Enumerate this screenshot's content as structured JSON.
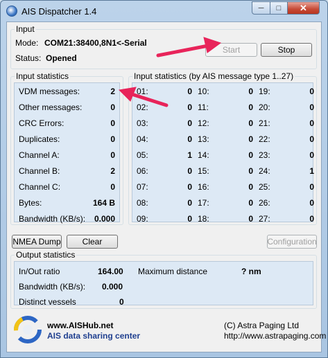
{
  "window": {
    "title": "AIS Dispatcher 1.4",
    "close_glyph": "✕",
    "min_glyph": "─",
    "max_glyph": "□"
  },
  "input": {
    "title": "Input",
    "mode_label": "Mode:",
    "mode_value": "COM21:38400,8N1<-Serial",
    "status_label": "Status:",
    "status_value": "Opened",
    "start_label": "Start",
    "stop_label": "Stop"
  },
  "input_stats": {
    "title": "Input statistics",
    "rows": [
      {
        "label": "VDM messages:",
        "value": "2"
      },
      {
        "label": "Other messages:",
        "value": "0"
      },
      {
        "label": "CRC Errors:",
        "value": "0"
      },
      {
        "label": "Duplicates:",
        "value": "0"
      },
      {
        "label": "Channel A:",
        "value": "0"
      },
      {
        "label": "Channel B:",
        "value": "2"
      },
      {
        "label": "Channel C:",
        "value": "0"
      },
      {
        "label": "Bytes:",
        "value": "164 B"
      },
      {
        "label": "Bandwidth (KB/s):",
        "value": "0.000"
      }
    ]
  },
  "type_stats": {
    "title": "Input statistics (by AIS message type 1..27)",
    "columns": [
      [
        {
          "label": "01:",
          "value": "0"
        },
        {
          "label": "02:",
          "value": "0"
        },
        {
          "label": "03:",
          "value": "0"
        },
        {
          "label": "04:",
          "value": "0"
        },
        {
          "label": "05:",
          "value": "1"
        },
        {
          "label": "06:",
          "value": "0"
        },
        {
          "label": "07:",
          "value": "0"
        },
        {
          "label": "08:",
          "value": "0"
        },
        {
          "label": "09:",
          "value": "0"
        }
      ],
      [
        {
          "label": "10:",
          "value": "0"
        },
        {
          "label": "11:",
          "value": "0"
        },
        {
          "label": "12:",
          "value": "0"
        },
        {
          "label": "13:",
          "value": "0"
        },
        {
          "label": "14:",
          "value": "0"
        },
        {
          "label": "15:",
          "value": "0"
        },
        {
          "label": "16:",
          "value": "0"
        },
        {
          "label": "17:",
          "value": "0"
        },
        {
          "label": "18:",
          "value": "0"
        }
      ],
      [
        {
          "label": "19:",
          "value": "0"
        },
        {
          "label": "20:",
          "value": "0"
        },
        {
          "label": "21:",
          "value": "0"
        },
        {
          "label": "22:",
          "value": "0"
        },
        {
          "label": "23:",
          "value": "0"
        },
        {
          "label": "24:",
          "value": "1"
        },
        {
          "label": "25:",
          "value": "0"
        },
        {
          "label": "26:",
          "value": "0"
        },
        {
          "label": "27:",
          "value": "0"
        }
      ]
    ]
  },
  "buttons": {
    "nmea_dump": "NMEA Dump",
    "clear": "Clear",
    "configuration": "Configuration"
  },
  "output_stats": {
    "title": "Output statistics",
    "inout_label": "In/Out ratio",
    "inout_value": "164.00",
    "bandwidth_label": "Bandwidth (KB/s):",
    "bandwidth_value": "0.000",
    "vessels_label": "Distinct vessels",
    "vessels_value": "0",
    "maxdist_label": "Maximum distance",
    "maxdist_value": "? nm"
  },
  "footer": {
    "site": "www.AISHub.net",
    "tagline": "AIS data sharing center",
    "copyright": "(C) Astra Paging Ltd",
    "url": "http://www.astrapaging.com"
  },
  "colors": {
    "annotation_arrow": "#e8245a",
    "tagline": "#1f3f8f",
    "panel_bg": "#dde9f5"
  }
}
